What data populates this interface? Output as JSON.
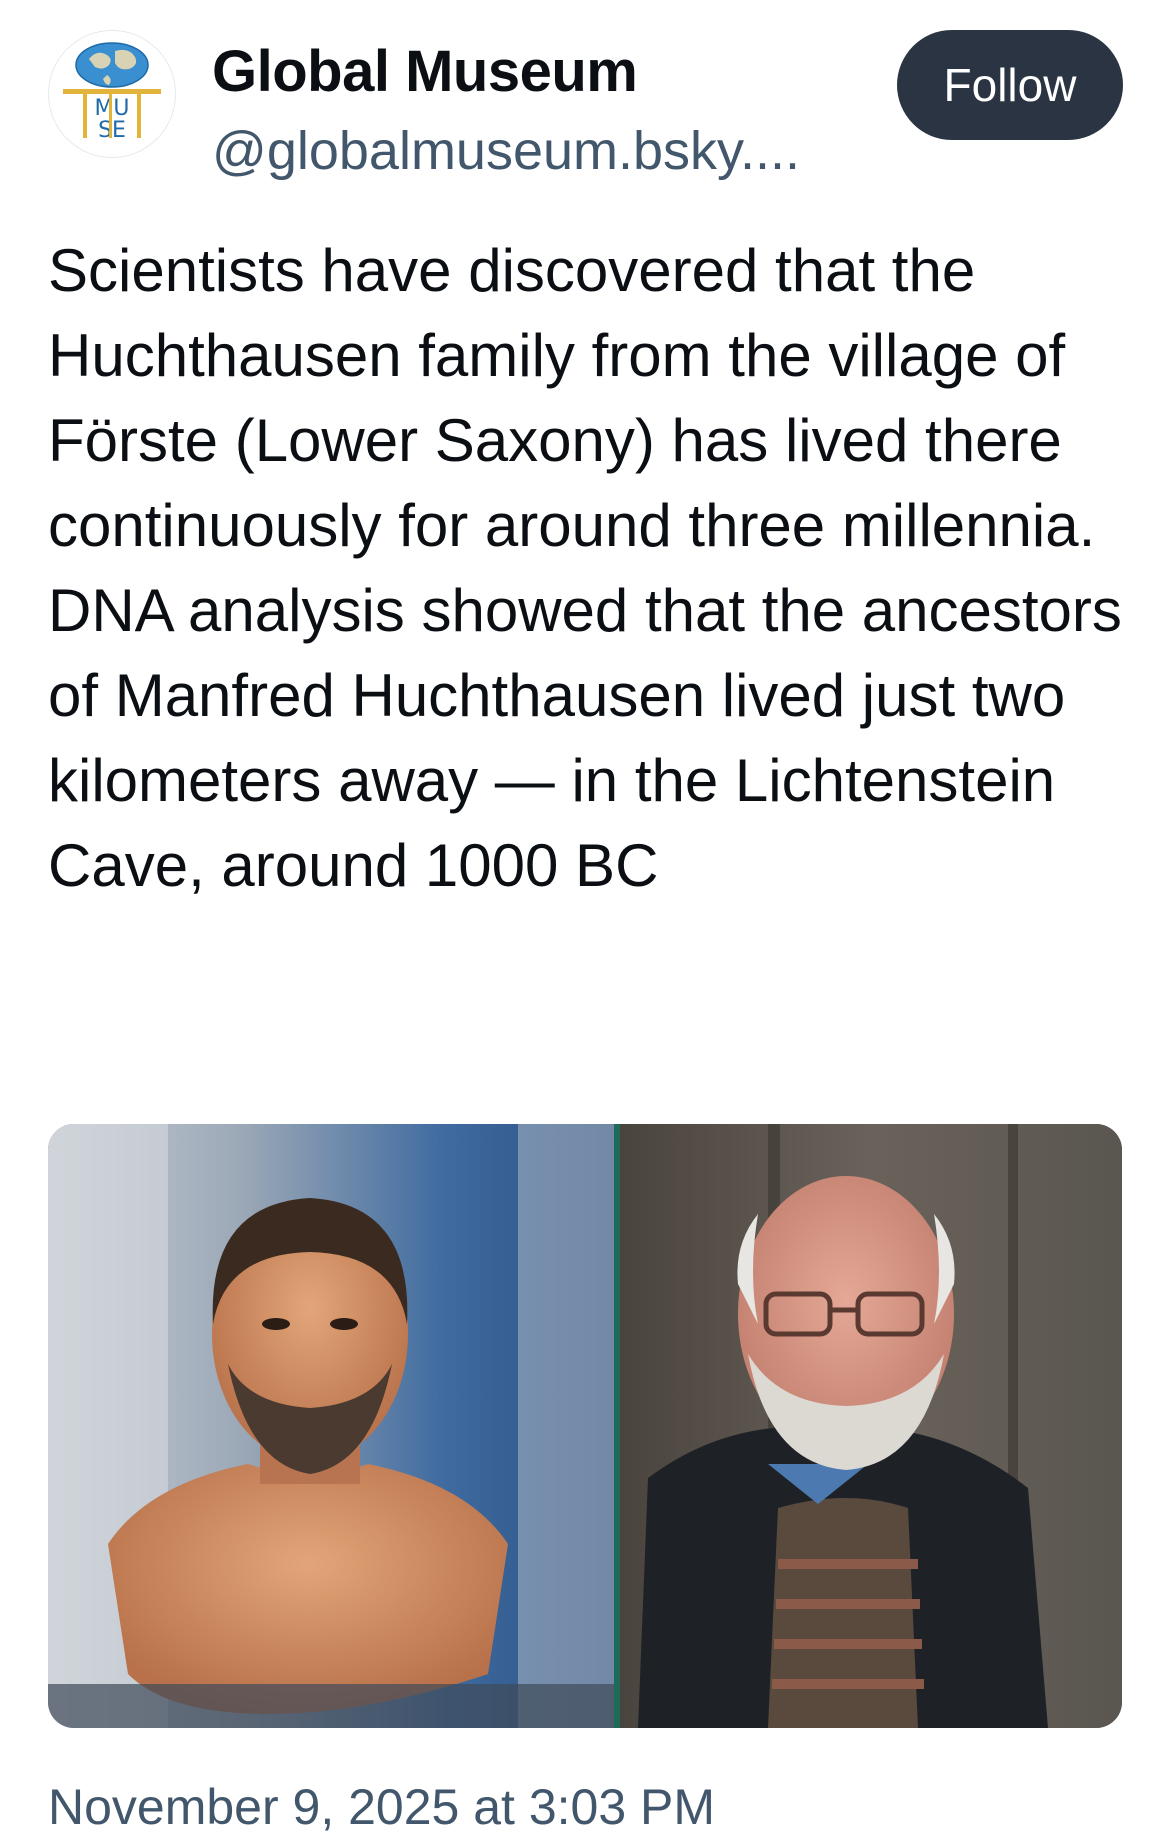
{
  "post": {
    "author": {
      "display_name": "Global Museum",
      "handle": "@globalmuseum.bsky....",
      "avatar_text": [
        "MU",
        "SE"
      ]
    },
    "follow_label": "Follow",
    "text": "Scientists have discovered that the Huchthausen family from the village of Förste (Lower Saxony) has lived there continuously for around three millennia.\nDNA analysis showed that the ancestors of Manfred Huchthausen lived just two kilometers away — in the Lichtenstein Cave, around 1000 BC",
    "timestamp": "November 9, 2025 at 3:03 PM"
  },
  "colors": {
    "follow_button_bg": "#2a3442",
    "secondary_text": "#42576c",
    "primary_text": "#0b0f14"
  },
  "icons": {
    "avatar": "globe-logo-icon"
  }
}
